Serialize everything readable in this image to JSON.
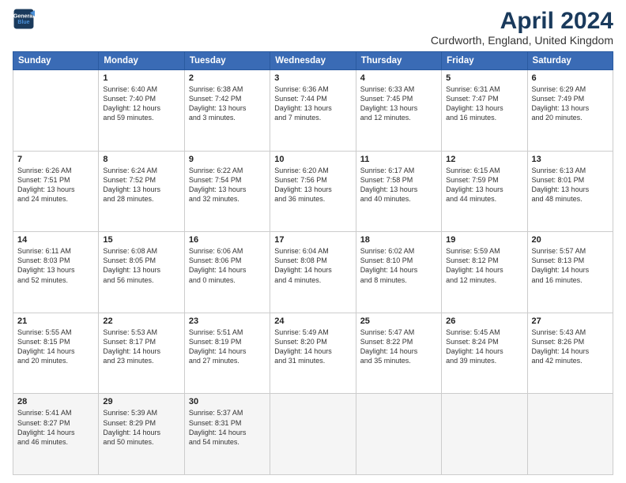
{
  "header": {
    "logo_line1": "General",
    "logo_line2": "Blue",
    "title": "April 2024",
    "subtitle": "Curdworth, England, United Kingdom"
  },
  "columns": [
    "Sunday",
    "Monday",
    "Tuesday",
    "Wednesday",
    "Thursday",
    "Friday",
    "Saturday"
  ],
  "weeks": [
    [
      {
        "day": "",
        "info": ""
      },
      {
        "day": "1",
        "info": "Sunrise: 6:40 AM\nSunset: 7:40 PM\nDaylight: 12 hours\nand 59 minutes."
      },
      {
        "day": "2",
        "info": "Sunrise: 6:38 AM\nSunset: 7:42 PM\nDaylight: 13 hours\nand 3 minutes."
      },
      {
        "day": "3",
        "info": "Sunrise: 6:36 AM\nSunset: 7:44 PM\nDaylight: 13 hours\nand 7 minutes."
      },
      {
        "day": "4",
        "info": "Sunrise: 6:33 AM\nSunset: 7:45 PM\nDaylight: 13 hours\nand 12 minutes."
      },
      {
        "day": "5",
        "info": "Sunrise: 6:31 AM\nSunset: 7:47 PM\nDaylight: 13 hours\nand 16 minutes."
      },
      {
        "day": "6",
        "info": "Sunrise: 6:29 AM\nSunset: 7:49 PM\nDaylight: 13 hours\nand 20 minutes."
      }
    ],
    [
      {
        "day": "7",
        "info": "Sunrise: 6:26 AM\nSunset: 7:51 PM\nDaylight: 13 hours\nand 24 minutes."
      },
      {
        "day": "8",
        "info": "Sunrise: 6:24 AM\nSunset: 7:52 PM\nDaylight: 13 hours\nand 28 minutes."
      },
      {
        "day": "9",
        "info": "Sunrise: 6:22 AM\nSunset: 7:54 PM\nDaylight: 13 hours\nand 32 minutes."
      },
      {
        "day": "10",
        "info": "Sunrise: 6:20 AM\nSunset: 7:56 PM\nDaylight: 13 hours\nand 36 minutes."
      },
      {
        "day": "11",
        "info": "Sunrise: 6:17 AM\nSunset: 7:58 PM\nDaylight: 13 hours\nand 40 minutes."
      },
      {
        "day": "12",
        "info": "Sunrise: 6:15 AM\nSunset: 7:59 PM\nDaylight: 13 hours\nand 44 minutes."
      },
      {
        "day": "13",
        "info": "Sunrise: 6:13 AM\nSunset: 8:01 PM\nDaylight: 13 hours\nand 48 minutes."
      }
    ],
    [
      {
        "day": "14",
        "info": "Sunrise: 6:11 AM\nSunset: 8:03 PM\nDaylight: 13 hours\nand 52 minutes."
      },
      {
        "day": "15",
        "info": "Sunrise: 6:08 AM\nSunset: 8:05 PM\nDaylight: 13 hours\nand 56 minutes."
      },
      {
        "day": "16",
        "info": "Sunrise: 6:06 AM\nSunset: 8:06 PM\nDaylight: 14 hours\nand 0 minutes."
      },
      {
        "day": "17",
        "info": "Sunrise: 6:04 AM\nSunset: 8:08 PM\nDaylight: 14 hours\nand 4 minutes."
      },
      {
        "day": "18",
        "info": "Sunrise: 6:02 AM\nSunset: 8:10 PM\nDaylight: 14 hours\nand 8 minutes."
      },
      {
        "day": "19",
        "info": "Sunrise: 5:59 AM\nSunset: 8:12 PM\nDaylight: 14 hours\nand 12 minutes."
      },
      {
        "day": "20",
        "info": "Sunrise: 5:57 AM\nSunset: 8:13 PM\nDaylight: 14 hours\nand 16 minutes."
      }
    ],
    [
      {
        "day": "21",
        "info": "Sunrise: 5:55 AM\nSunset: 8:15 PM\nDaylight: 14 hours\nand 20 minutes."
      },
      {
        "day": "22",
        "info": "Sunrise: 5:53 AM\nSunset: 8:17 PM\nDaylight: 14 hours\nand 23 minutes."
      },
      {
        "day": "23",
        "info": "Sunrise: 5:51 AM\nSunset: 8:19 PM\nDaylight: 14 hours\nand 27 minutes."
      },
      {
        "day": "24",
        "info": "Sunrise: 5:49 AM\nSunset: 8:20 PM\nDaylight: 14 hours\nand 31 minutes."
      },
      {
        "day": "25",
        "info": "Sunrise: 5:47 AM\nSunset: 8:22 PM\nDaylight: 14 hours\nand 35 minutes."
      },
      {
        "day": "26",
        "info": "Sunrise: 5:45 AM\nSunset: 8:24 PM\nDaylight: 14 hours\nand 39 minutes."
      },
      {
        "day": "27",
        "info": "Sunrise: 5:43 AM\nSunset: 8:26 PM\nDaylight: 14 hours\nand 42 minutes."
      }
    ],
    [
      {
        "day": "28",
        "info": "Sunrise: 5:41 AM\nSunset: 8:27 PM\nDaylight: 14 hours\nand 46 minutes."
      },
      {
        "day": "29",
        "info": "Sunrise: 5:39 AM\nSunset: 8:29 PM\nDaylight: 14 hours\nand 50 minutes."
      },
      {
        "day": "30",
        "info": "Sunrise: 5:37 AM\nSunset: 8:31 PM\nDaylight: 14 hours\nand 54 minutes."
      },
      {
        "day": "",
        "info": ""
      },
      {
        "day": "",
        "info": ""
      },
      {
        "day": "",
        "info": ""
      },
      {
        "day": "",
        "info": ""
      }
    ]
  ]
}
